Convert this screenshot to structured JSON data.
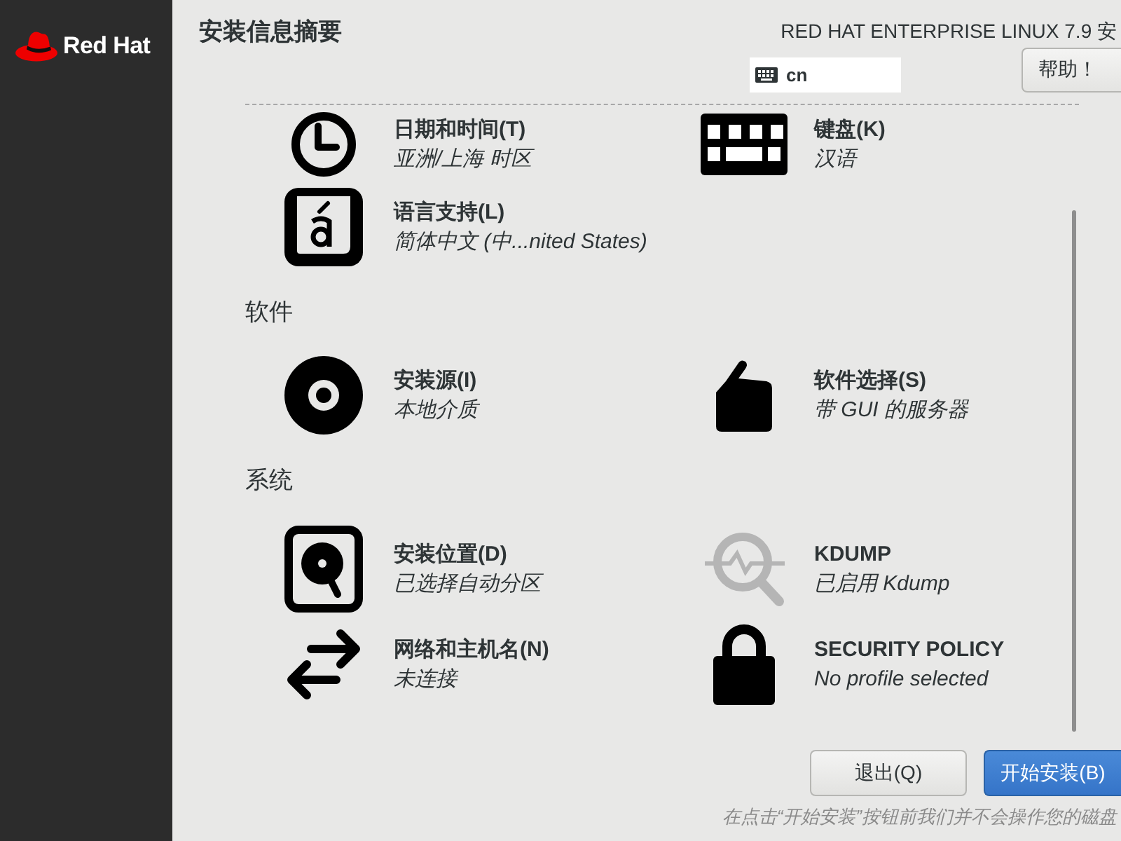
{
  "sidebar": {
    "logo_text": "Red Hat"
  },
  "header": {
    "title": "安装信息摘要",
    "product": "RED HAT ENTERPRISE LINUX 7.9 安",
    "keyboard_layout": "cn",
    "help_button": "帮助！"
  },
  "sections": [
    {
      "items": [
        {
          "kind": "clock",
          "title": "日期和时间(T)",
          "status": "亚洲/上海 时区"
        },
        {
          "kind": "keyboard",
          "title": "键盘(K)",
          "status": "汉语"
        },
        {
          "kind": "language",
          "title": "语言支持(L)",
          "status": "简体中文 (中...nited States)"
        }
      ]
    },
    {
      "heading": "软件",
      "items": [
        {
          "kind": "disc",
          "title": "安装源(I)",
          "status": "本地介质"
        },
        {
          "kind": "package",
          "title": "软件选择(S)",
          "status": "带 GUI 的服务器"
        }
      ]
    },
    {
      "heading": "系统",
      "items": [
        {
          "kind": "disk",
          "title": "安装位置(D)",
          "status": "已选择自动分区"
        },
        {
          "kind": "kdump",
          "title": "KDUMP",
          "status": "已启用 Kdump"
        },
        {
          "kind": "network",
          "title": "网络和主机名(N)",
          "status": "未连接"
        },
        {
          "kind": "lock",
          "title": "SECURITY POLICY",
          "status": "No profile selected"
        }
      ]
    }
  ],
  "buttons": [
    {
      "label": "退出(Q)",
      "kind": "secondary"
    },
    {
      "label": "开始安装(B)",
      "kind": "primary"
    }
  ],
  "hint": "在点击“开始安装”按钮前我们并不会操作您的磁盘"
}
